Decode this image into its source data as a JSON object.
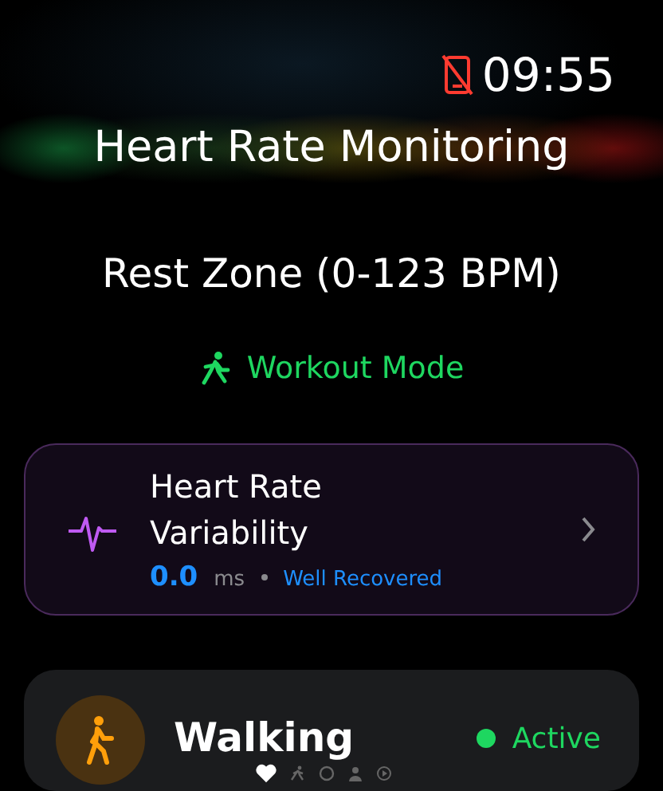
{
  "status_bar": {
    "time": "09:55",
    "phone_disconnected": true
  },
  "title": "Heart Rate Monitoring",
  "zone": "Rest Zone (0-123 BPM)",
  "mode": {
    "label": "Workout Mode"
  },
  "hrv_card": {
    "title": "Heart Rate Variability",
    "value": "0.0",
    "unit": "ms",
    "status": "Well Recovered"
  },
  "activity_card": {
    "name": "Walking",
    "status": "Active",
    "color": "#1ed760"
  },
  "page_indicator": [
    {
      "kind": "heart",
      "selected": true
    },
    {
      "kind": "runner",
      "selected": false
    },
    {
      "kind": "circle",
      "selected": false
    },
    {
      "kind": "person",
      "selected": false
    },
    {
      "kind": "play",
      "selected": false
    }
  ]
}
